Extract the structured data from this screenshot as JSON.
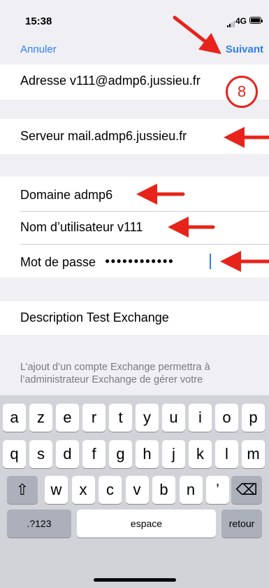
{
  "status": {
    "time": "15:38",
    "network": "4G"
  },
  "nav": {
    "cancel": "Annuler",
    "next": "Suivant"
  },
  "fields": {
    "address": "Adresse   v111@admp6.jussieu.fr",
    "server": "Serveur   mail.admp6.jussieu.fr",
    "domain": "Domaine  admp6",
    "username": "Nom d’utilisateur  v111",
    "password_label": "Mot de passe",
    "password_mask": "●●●●●●●●●●●●",
    "description": "Description  Test Exchange"
  },
  "annotation": {
    "step": "8",
    "accent": "#e8231b"
  },
  "footer_note": "L’ajout d’un compte Exchange permettra à l’administrateur Exchange de gérer votre",
  "keyboard": {
    "row1": [
      "a",
      "z",
      "e",
      "r",
      "t",
      "y",
      "u",
      "i",
      "o",
      "p"
    ],
    "row2": [
      "q",
      "s",
      "d",
      "f",
      "g",
      "h",
      "j",
      "k",
      "l",
      "m"
    ],
    "row3": [
      "w",
      "x",
      "c",
      "v",
      "b",
      "n",
      "’"
    ],
    "shift_icon": "⇧",
    "delete_icon": "⌫",
    "numbers": ".?123",
    "space": "espace",
    "return": "retour"
  },
  "colors": {
    "link": "#2f7ef5",
    "background": "#efeff4",
    "keyboard": "#d1d3d9"
  }
}
